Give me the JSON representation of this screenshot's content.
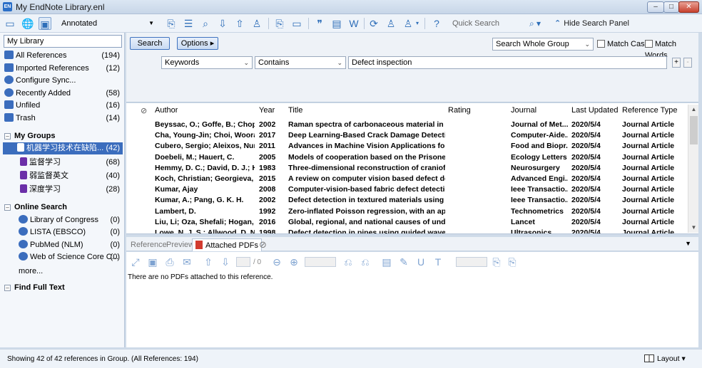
{
  "window": {
    "title": "My EndNote Library.enl",
    "app_badge": "EN",
    "controls": {
      "minimize": "–",
      "maximize": "□",
      "close": "✕"
    }
  },
  "toolbar": {
    "style_value": "Annotated",
    "quick_search_placeholder": "Quick Search",
    "hide_panel_label": "Hide Search Panel"
  },
  "sidebar": {
    "library_label": "My Library",
    "items": [
      {
        "label": "All References",
        "count": "(194)",
        "icon": "all-references-icon",
        "color": "#3b6dbd"
      },
      {
        "label": "Imported References",
        "count": "(12)",
        "icon": "import-icon",
        "color": "#3b6dbd"
      },
      {
        "label": "Configure Sync...",
        "count": "",
        "icon": "sync-icon",
        "color": "#3b6dbd"
      },
      {
        "label": "Recently Added",
        "count": "(58)",
        "icon": "clock-icon",
        "color": "#3b6dbd"
      },
      {
        "label": "Unfiled",
        "count": "(16)",
        "icon": "unfiled-icon",
        "color": "#3b6dbd"
      },
      {
        "label": "Trash",
        "count": "(14)",
        "icon": "trash-icon",
        "color": "#3b6dbd"
      }
    ],
    "my_groups_label": "My Groups",
    "groups": [
      {
        "label": "机器学习技术在缺陷...",
        "count": "(42)",
        "selected": true
      },
      {
        "label": "监督学习",
        "count": "(68)",
        "selected": false
      },
      {
        "label": "弱监督英文",
        "count": "(40)",
        "selected": false
      },
      {
        "label": "深度学习",
        "count": "(28)",
        "selected": false
      }
    ],
    "online_search_label": "Online Search",
    "online": [
      {
        "label": "Library of Congress",
        "count": "(0)"
      },
      {
        "label": "LISTA (EBSCO)",
        "count": "(0)"
      },
      {
        "label": "PubMed (NLM)",
        "count": "(0)"
      },
      {
        "label": "Web of Science Core C...",
        "count": "(0)"
      }
    ],
    "more_label": "more...",
    "find_full_text_label": "Find Full Text"
  },
  "search_panel": {
    "search_button": "Search",
    "options_button": "Options ▸",
    "scope_value": "Search Whole Group",
    "match_case_label": "Match Case",
    "match_words_label": "Match Words",
    "field_value": "Keywords",
    "operator_value": "Contains",
    "term_value": "Defect inspection",
    "add_label": "+",
    "remove_label": "-"
  },
  "references": {
    "columns": [
      "Author",
      "Year",
      "Title",
      "Rating",
      "Journal",
      "Last Updated",
      "Reference Type"
    ],
    "rows": [
      [
        "Beyssac, O.; Goffe, B.; Chopin...",
        "2002",
        "Raman spectra of carbonaceous material in me...",
        "",
        "Journal of Met...",
        "2020/5/4",
        "Journal Article"
      ],
      [
        "Cha, Young-Jin; Choi, Woora...",
        "2017",
        "Deep Learning-Based Crack Damage Detectio...",
        "",
        "Computer-Aide...",
        "2020/5/4",
        "Journal Article"
      ],
      [
        "Cubero, Sergio; Aleixos, Nuri...",
        "2011",
        "Advances in Machine Vision Applications for A...",
        "",
        "Food and Biopr...",
        "2020/5/4",
        "Journal Article"
      ],
      [
        "Doebeli, M.; Hauert, C.",
        "2005",
        "Models of cooperation based on the Prisoner's ...",
        "",
        "Ecology Letters",
        "2020/5/4",
        "Journal Article"
      ],
      [
        "Hemmy, D. C.; David, D. J.; He...",
        "1983",
        "Three-dimensional reconstruction of craniofac...",
        "",
        "Neurosurgery",
        "2020/5/4",
        "Journal Article"
      ],
      [
        "Koch, Christian; Georgieva, K...",
        "2015",
        "A review on computer vision based defect det...",
        "",
        "Advanced Engi...",
        "2020/5/4",
        "Journal Article"
      ],
      [
        "Kumar, Ajay",
        "2008",
        "Computer-vision-based fabric defect detectio...",
        "",
        "Ieee Transactio...",
        "2020/5/4",
        "Journal Article"
      ],
      [
        "Kumar, A.; Pang, G. K. H.",
        "2002",
        "Defect detection in textured materials using g...",
        "",
        "Ieee Transactio...",
        "2020/5/4",
        "Journal Article"
      ],
      [
        "Lambert, D.",
        "1992",
        "Zero-inflated Poisson regression, with an appli...",
        "",
        "Technometrics",
        "2020/5/4",
        "Journal Article"
      ],
      [
        "Liu, Li; Oza, Shefali; Hogan, D...",
        "2016",
        "Global, regional, and national causes of under-...",
        "",
        "Lancet",
        "2020/5/4",
        "Journal Article"
      ],
      [
        "Lowe, N. J. S.; Allwood, D. N...",
        "1998",
        "Defect detection in pipes using guided waves...",
        "",
        "Ultrasonics",
        "2020/5/4",
        "Journal Article"
      ]
    ]
  },
  "tabs": {
    "reference": "Reference",
    "preview": "Preview",
    "attached_pdfs": "Attached PDFs"
  },
  "pdf_viewer": {
    "page_total": "/ 0",
    "empty_message": "There are no PDFs attached to this reference."
  },
  "status": {
    "text": "Showing 42 of 42 references in Group. (All References: 194)",
    "layout_label": "Layout"
  }
}
